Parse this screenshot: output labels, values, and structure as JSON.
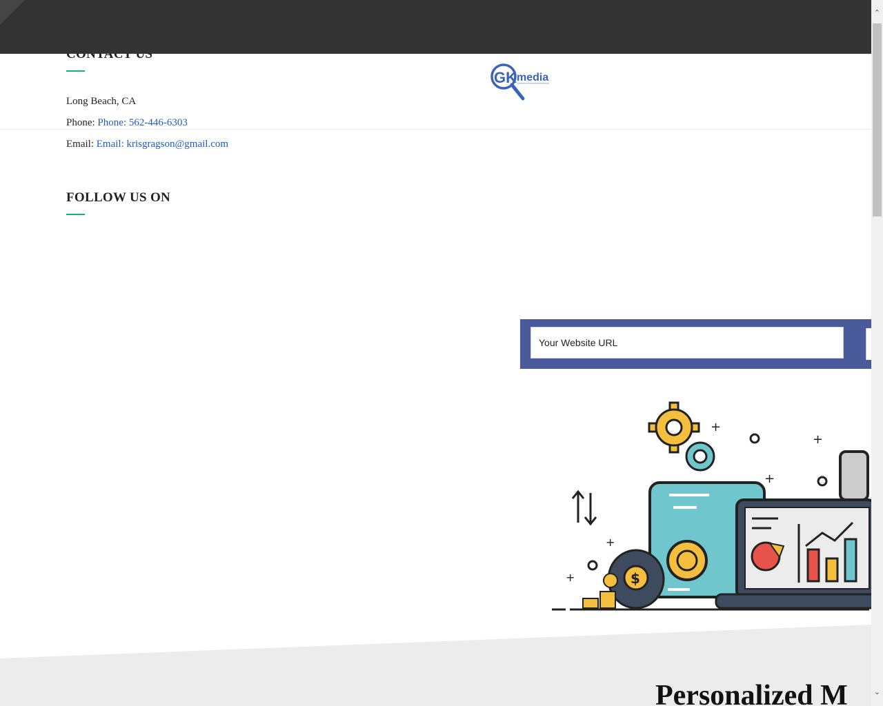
{
  "contact": {
    "heading": "CONTACT US",
    "city": "Long Beach, CA",
    "phone_label": "Phone: ",
    "phone_link": "Phone: 562-446-6303",
    "email_label": "Email: ",
    "email_link": "Email: krisgragson@gmail.com"
  },
  "follow": {
    "heading": "FOLLOW US ON"
  },
  "logo": {
    "text": "media",
    "letters": "GK"
  },
  "form": {
    "url_placeholder": "Your Website URL"
  },
  "hero": {
    "title": "Personalized M"
  },
  "colors": {
    "topbar": "#333333",
    "accent_green": "#17b070",
    "link": "#1e5bc6",
    "form_band": "#4a5b9c",
    "gray_band": "#ececec"
  }
}
